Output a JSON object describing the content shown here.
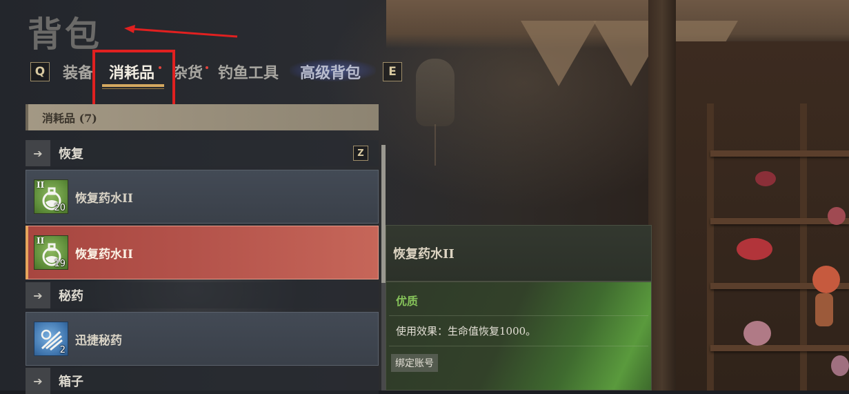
{
  "window": {
    "title": "背包"
  },
  "tabs": {
    "prev_key": "Q",
    "next_key": "E",
    "items": [
      {
        "label": "装备",
        "active": false,
        "new_dot": false
      },
      {
        "label": "消耗品",
        "active": true,
        "new_dot": true
      },
      {
        "label": "杂货",
        "active": false,
        "new_dot": true
      },
      {
        "label": "钓鱼工具",
        "active": false,
        "new_dot": false
      },
      {
        "label": "高级背包",
        "active": false,
        "new_dot": false
      }
    ]
  },
  "list": {
    "header": "消耗品 (7)",
    "groups": [
      {
        "label": "恢复",
        "key": "Z"
      },
      {
        "label": "秘药"
      },
      {
        "label": "箱子"
      }
    ],
    "items": [
      {
        "name": "恢复药水II",
        "tier": "II",
        "count": "20",
        "icon": "potion-icon",
        "selected": false
      },
      {
        "name": "恢复药水II",
        "tier": "II",
        "count": "19",
        "icon": "potion-icon",
        "selected": true
      },
      {
        "name": "迅捷秘药",
        "count": "2",
        "icon": "swift-elixir-icon",
        "selected": false
      }
    ]
  },
  "tooltip": {
    "name": "恢复药水II",
    "grade": "优质",
    "effect": "使用效果：生命值恢复1000。",
    "binding": "绑定账号"
  },
  "colors": {
    "highlight_box": "#e02020",
    "annotation_arrow": "#e02020",
    "tab_underline": "#d4a860",
    "selected_row": "#b3524a",
    "grade_text": "#86c35a",
    "new_dot": "#e2443d"
  }
}
